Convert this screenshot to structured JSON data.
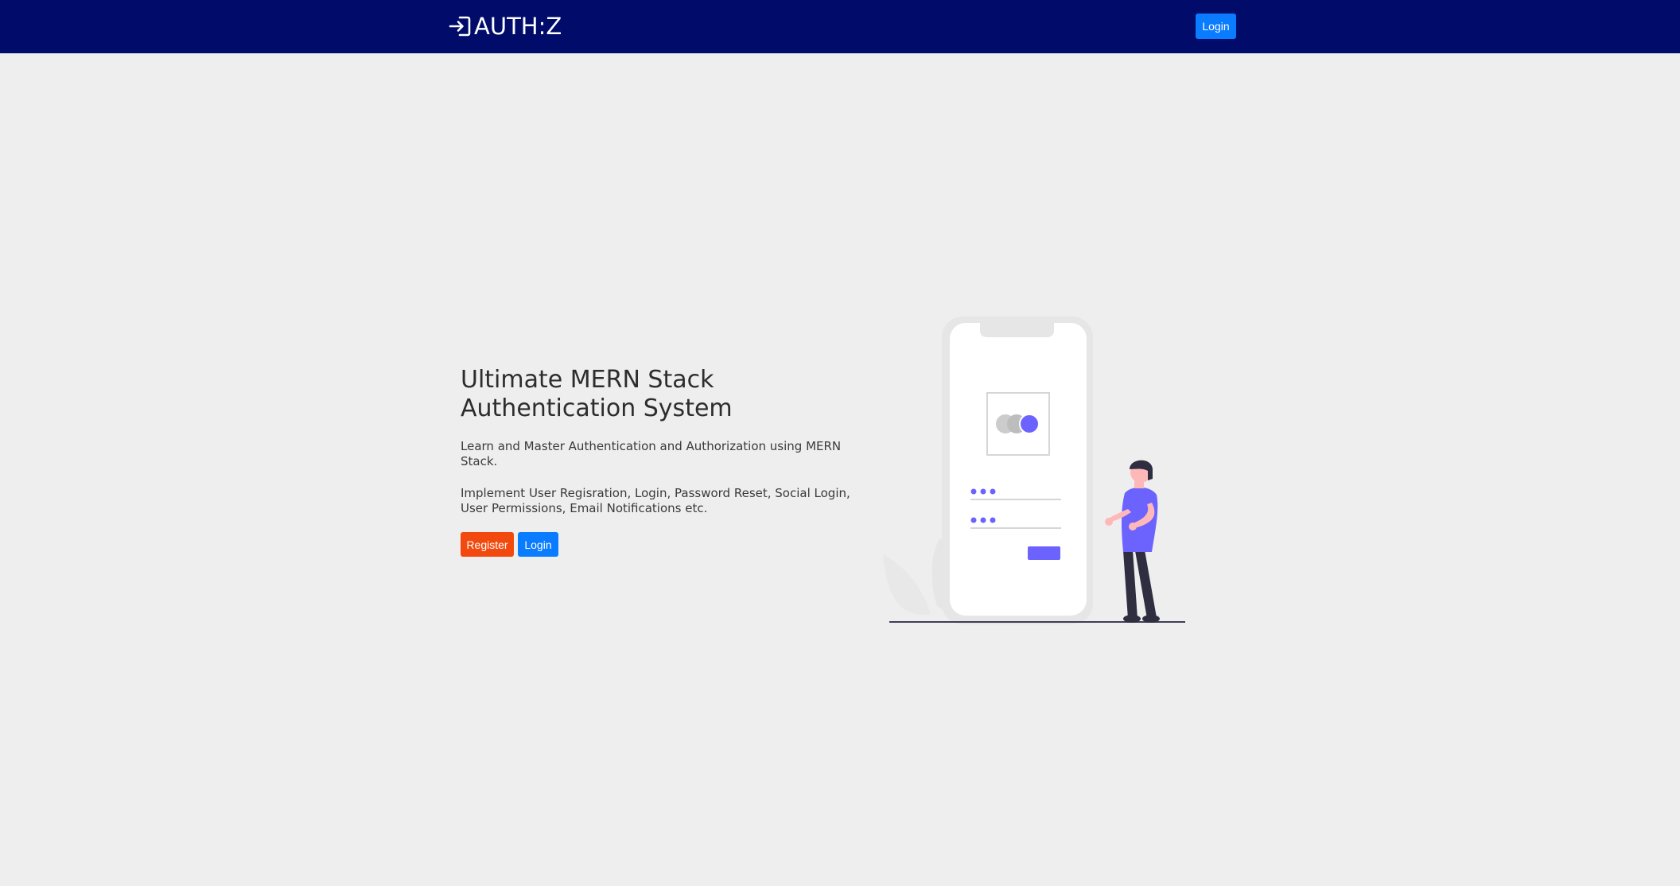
{
  "navbar": {
    "brand": "AUTH:Z",
    "brand_icon": "sign-in-icon",
    "login_label": "Login"
  },
  "hero": {
    "title": "Ultimate MERN Stack Authentication System",
    "paragraph1": "Learn and Master Authentication and Authorization using MERN Stack.",
    "paragraph2": "Implement User Regisration, Login, Password Reset, Social Login, User Permissions, Email Notifications etc.",
    "register_label": "Register",
    "login_label": "Login"
  },
  "colors": {
    "navbar_bg": "#000b6a",
    "page_bg": "#eeeeee",
    "primary": "#0a7cff",
    "register": "#f24a0e",
    "accent": "#6c63ff"
  },
  "illustration": {
    "icon": "phone-login-illustration"
  }
}
